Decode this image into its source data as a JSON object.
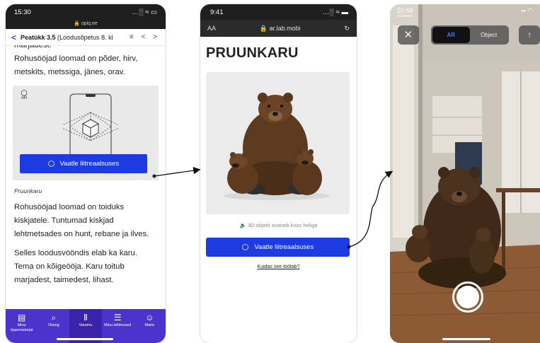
{
  "phone1": {
    "status": {
      "time": "15:30",
      "signal": "…░ ≈ ▭"
    },
    "url": "🔒 opiq.ee",
    "nav": {
      "back": "<",
      "title_bold": "Peatükk 3.5",
      "title_rest": " (Loodusõpetus 8. kl",
      "icons": "≡ < >"
    },
    "text_cut": "marjadest.",
    "para1": "Rohusööjad loomad on põder, hirv, metskits, metssiga, jänes, orav.",
    "ar_badge": "AR",
    "ar_button": "Vaatle liitreaalsuses",
    "caption": "Pruunkaru",
    "para2": "Rohusööjad loomad on toiduks kiskjatele. Tuntumad kiskjad lehtmetsades on hunt, rebane ja ilves.",
    "para3": "Selles loodusvööndis elab ka karu. Tema on kõigeööja. Karu toitub marjadest, taimedest, lihast.",
    "tabs": [
      {
        "icon": "▤",
        "label": "Minu õppematerjal"
      },
      {
        "icon": "⌕",
        "label": "Otsing"
      },
      {
        "icon": "Ⅱ",
        "label": "Varamu"
      },
      {
        "icon": "☰",
        "label": "Minu tellimused"
      },
      {
        "icon": "☺",
        "label": "Marie"
      }
    ]
  },
  "phone2": {
    "status": {
      "time": "9:41",
      "icons": "…░ ≈ ▬"
    },
    "url": {
      "aa": "AA",
      "host": "🔒 ar.lab.mobi",
      "reload": "↻"
    },
    "title": "PRUUNKARU",
    "sound_note": "3D objekt avaneb koos heliga",
    "sound_icon": "🔉",
    "ar_button": "Vaatle liitreaalsuses",
    "how_link": "Kuidas see töötab?"
  },
  "phone3": {
    "status": {
      "time": "10:58",
      "back_app": "◂ Camera"
    },
    "segments": {
      "ar": "AR",
      "object": "Object"
    },
    "close": "✕",
    "share": "↑"
  },
  "colors": {
    "accent_blue": "#1d3be0",
    "tabbar_purple": "#4c33cc"
  }
}
